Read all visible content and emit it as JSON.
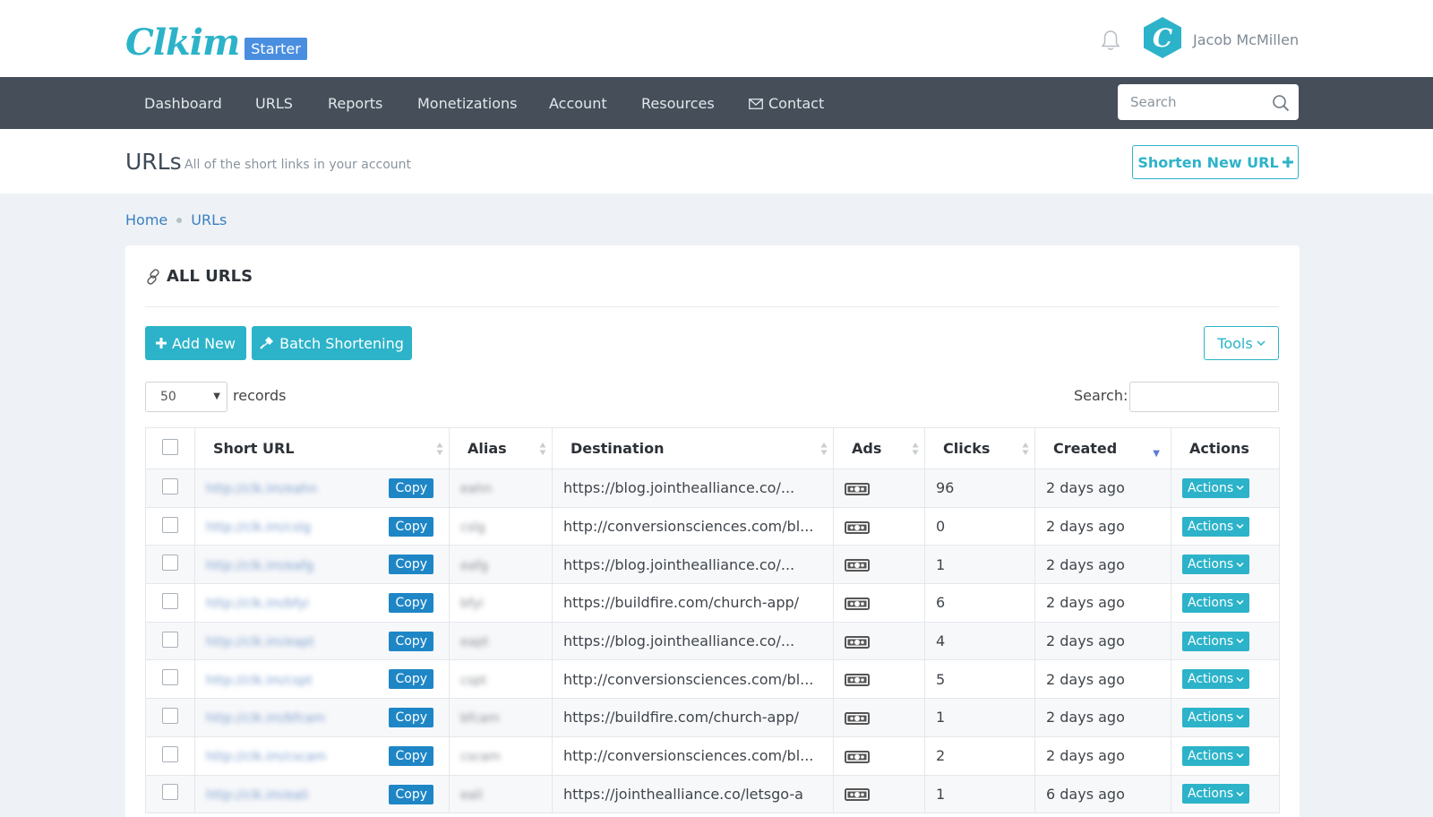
{
  "app": {
    "logo_text": "Clkim",
    "plan_badge": "Starter"
  },
  "user": {
    "name": "Jacob McMillen",
    "avatar_letter": "C"
  },
  "nav": {
    "items": [
      {
        "label": "Dashboard"
      },
      {
        "label": "URLS"
      },
      {
        "label": "Reports"
      },
      {
        "label": "Monetizations"
      },
      {
        "label": "Account"
      },
      {
        "label": "Resources"
      },
      {
        "label": "Contact"
      }
    ],
    "search_placeholder": "Search"
  },
  "page": {
    "title": "URLs",
    "subtitle": "All of the short links in your account",
    "shorten_button": "Shorten New URL"
  },
  "breadcrumb": [
    "Home",
    "URLs"
  ],
  "card": {
    "title": "ALL URLS",
    "add_new": "Add New",
    "batch": "Batch Shortening",
    "tools": "Tools",
    "records_value": "50",
    "records_label": "records",
    "search_label": "Search:"
  },
  "table": {
    "columns": [
      "Short URL",
      "Alias",
      "Destination",
      "Ads",
      "Clicks",
      "Created",
      "Actions"
    ],
    "copy_label": "Copy",
    "actions_label": "Actions",
    "rows": [
      {
        "short_url": "http://clk.im/eahn",
        "alias": "eahn",
        "destination": "https://blog.jointhealliance.co/...",
        "clicks": "96",
        "created": "2 days ago"
      },
      {
        "short_url": "http://clk.im/cslg",
        "alias": "cslg",
        "destination": "http://conversionsciences.com/bl...",
        "clicks": "0",
        "created": "2 days ago"
      },
      {
        "short_url": "http://clk.im/eafg",
        "alias": "eafg",
        "destination": "https://blog.jointhealliance.co/...",
        "clicks": "1",
        "created": "2 days ago"
      },
      {
        "short_url": "http://clk.im/bfyi",
        "alias": "bfyi",
        "destination": "https://buildfire.com/church-app/",
        "clicks": "6",
        "created": "2 days ago"
      },
      {
        "short_url": "http://clk.im/eapt",
        "alias": "eapt",
        "destination": "https://blog.jointhealliance.co/...",
        "clicks": "4",
        "created": "2 days ago"
      },
      {
        "short_url": "http://clk.im/cspt",
        "alias": "cspt",
        "destination": "http://conversionsciences.com/bl...",
        "clicks": "5",
        "created": "2 days ago"
      },
      {
        "short_url": "http://clk.im/bfcam",
        "alias": "bfcam",
        "destination": "https://buildfire.com/church-app/",
        "clicks": "1",
        "created": "2 days ago"
      },
      {
        "short_url": "http://clk.im/cscam",
        "alias": "cscam",
        "destination": "http://conversionsciences.com/bl...",
        "clicks": "2",
        "created": "2 days ago"
      },
      {
        "short_url": "http://clk.im/eali",
        "alias": "eali",
        "destination": "https://jointhealliance.co/letsgo-a",
        "clicks": "1",
        "created": "6 days ago"
      }
    ]
  },
  "colors": {
    "accent": "#2cb3c9",
    "nav_bg": "#454e59",
    "copy_blue": "#1f86c6",
    "link_blue": "#3b7fc0"
  },
  "icons": [
    "bell-icon",
    "search-icon",
    "mail-icon",
    "link-icon",
    "plus-icon",
    "plug-icon",
    "chevron-down-icon",
    "money-icon"
  ]
}
